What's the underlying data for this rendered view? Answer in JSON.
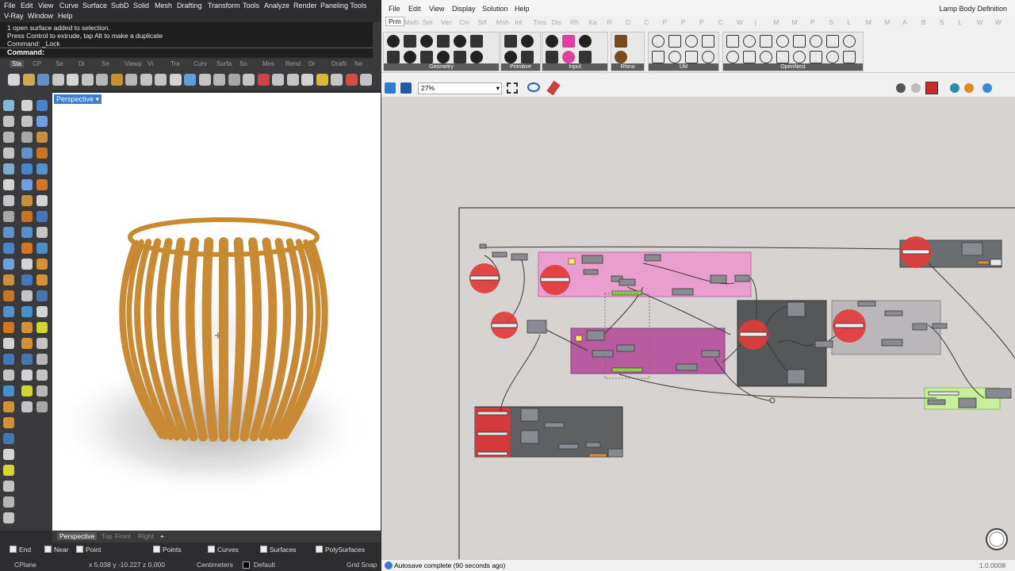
{
  "rhino": {
    "menu_row1": [
      "File",
      "Edit",
      "View",
      "Curve",
      "Surface",
      "SubD",
      "Solid",
      "Mesh",
      "Drafting",
      "Transform",
      "Tools",
      "Analyze",
      "Render",
      "Paneling Tools"
    ],
    "menu_row2": [
      "V-Ray",
      "Window",
      "Help"
    ],
    "command_history": [
      "1 open surface added to selection.",
      "Press Control to extrude, tap Alt to make a duplicate",
      "Command: _Lock"
    ],
    "command_prompt": "Command:",
    "toolbar_tabs": [
      "Sta",
      "CP",
      "Se",
      "Di",
      "Se",
      "Viewp",
      "Vi",
      "Tra",
      "Curv",
      "Surfa",
      "So",
      "Mes",
      "Rend",
      "Dr",
      "Drafti",
      "Ne"
    ],
    "viewport_label": "Perspective",
    "viewport_tabs": [
      "Perspective",
      "Top",
      "Front",
      "Right",
      "+"
    ],
    "osnaps": [
      "End",
      "Near",
      "Point",
      "Points",
      "Curves",
      "Surfaces",
      "PolySurfaces"
    ],
    "status": {
      "cplane": "CPlane",
      "coords": "x 5.038  y -10.227  z 0.000",
      "units": "Centimeters",
      "layer": "Default",
      "grid": "Grid Snap"
    }
  },
  "gh": {
    "menu": [
      "File",
      "Edit",
      "View",
      "Display",
      "Solution",
      "Help"
    ],
    "title": "Lamp Body Definition",
    "tabs": [
      "Prm",
      "Math",
      "Set",
      "Vec",
      "Crv",
      "Srf",
      "Msh",
      "Int",
      "Trns",
      "Dis",
      "Rh",
      "Ka",
      "R",
      "D",
      "C",
      "P",
      "P",
      "P",
      "C",
      "W",
      "j",
      "M",
      "M",
      "P",
      "S",
      "L",
      "M",
      "M",
      "A",
      "B",
      "S",
      "L",
      "W",
      "W"
    ],
    "ribbon_groups": [
      "Geometry",
      "Primitive",
      "Input",
      "Rhino",
      "Util",
      "OpenNest"
    ],
    "zoom": "27%",
    "status_text": "Autosave complete (90 seconds ago)",
    "version": "1.0.0008"
  }
}
